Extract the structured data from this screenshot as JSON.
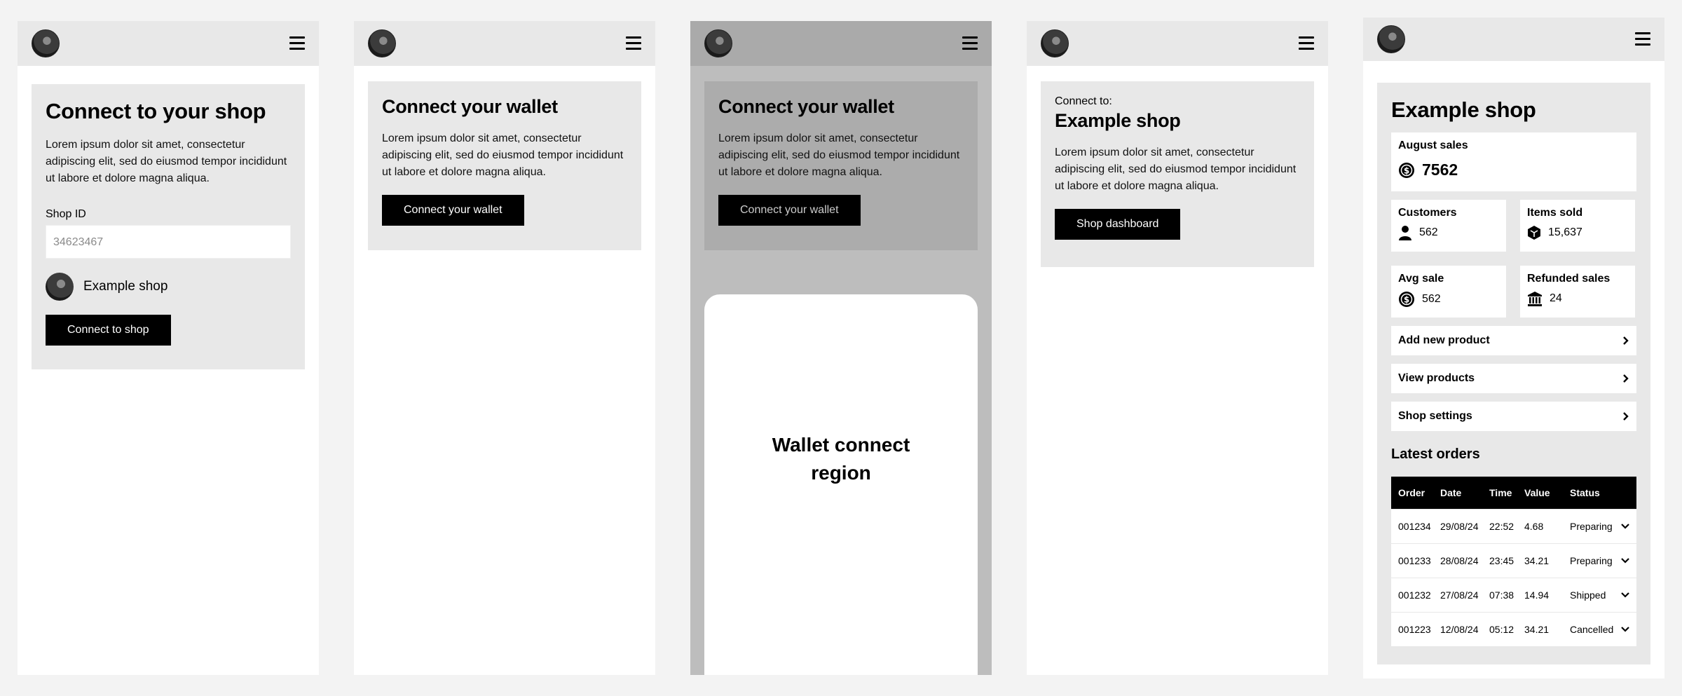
{
  "screen1": {
    "title": "Connect to your shop",
    "body": "Lorem ipsum dolor sit amet, consectetur adipiscing elit, sed do eiusmod tempor incididunt ut labore et dolore magna aliqua.",
    "shop_id_label": "Shop ID",
    "shop_id_placeholder": "34623467",
    "shop_name": "Example shop",
    "connect_button": "Connect to shop"
  },
  "screen2": {
    "title": "Connect your wallet",
    "body": "Lorem ipsum dolor sit amet, consectetur adipiscing elit, sed do eiusmod tempor incididunt ut labore et dolore magna aliqua.",
    "connect_button": "Connect your wallet"
  },
  "screen3": {
    "title": "Connect your wallet",
    "body": "Lorem ipsum dolor sit amet, consectetur adipiscing elit, sed do eiusmod tempor incididunt ut labore et dolore magna aliqua.",
    "connect_button": "Connect your wallet",
    "modal_text": "Wallet connect region"
  },
  "screen4": {
    "connect_to": "Connect to:",
    "title": "Example shop",
    "body": "Lorem ipsum dolor sit amet, consectetur adipiscing elit, sed do eiusmod tempor incididunt ut labore et dolore magna aliqua.",
    "dashboard_button": "Shop dashboard"
  },
  "screen5": {
    "title": "Example shop",
    "august_sales_label": "August sales",
    "august_sales_value": "7562",
    "customers_label": "Customers",
    "customers_value": "562",
    "items_sold_label": "Items sold",
    "items_sold_value": "15,637",
    "avg_sale_label": "Avg sale",
    "avg_sale_value": "562",
    "refunded_label": "Refunded sales",
    "refunded_value": "24",
    "links": [
      "Add new product",
      "View products",
      "Shop settings"
    ],
    "latest_orders": "Latest orders",
    "table_headers": [
      "Order",
      "Date",
      "Time",
      "Value",
      "Status"
    ],
    "orders": [
      [
        "001234",
        "29/08/24",
        "22:52",
        "4.68",
        "Preparing"
      ],
      [
        "001233",
        "28/08/24",
        "23:45",
        "34.21",
        "Preparing"
      ],
      [
        "001232",
        "27/08/24",
        "07:38",
        "14.94",
        "Shipped"
      ],
      [
        "001223",
        "12/08/24",
        "05:12",
        "34.21",
        "Cancelled"
      ]
    ]
  },
  "icons": {
    "avatar": "avatar-image",
    "menu": "hamburger-menu-icon",
    "coin": "dollar-coin-icon",
    "person": "person-icon",
    "items": "box-icon",
    "bank": "bank-icon",
    "chevron_right": "chevron-right-icon",
    "chevron_down": "chevron-down-icon"
  }
}
